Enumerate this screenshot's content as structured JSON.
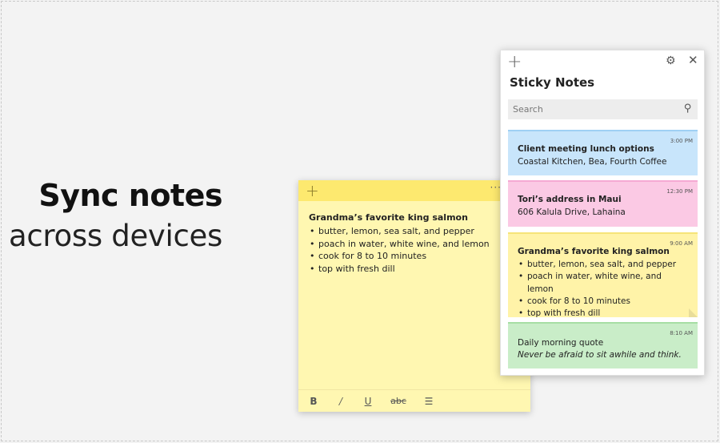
{
  "hero": {
    "line1": "Sync notes",
    "line2": "across devices"
  },
  "open_note": {
    "add_icon": "plus-icon",
    "menu_label": "···",
    "title": "Grandma’s favorite king salmon",
    "items": [
      "butter, lemon, sea salt, and pepper",
      "poach in water, white wine, and lemon",
      "cook for 8 to 10 minutes",
      "top with fresh dill"
    ],
    "toolbar": {
      "bold": "B",
      "italic": "/",
      "underline": "U",
      "strike": "abc",
      "list": "☰"
    },
    "color": "#fff7b1"
  },
  "panel": {
    "add_icon": "+",
    "gear_icon": "⚙",
    "close_icon": "✕",
    "title": "Sticky Notes",
    "search_placeholder": "Search",
    "search_icon": "⚲",
    "notes": [
      {
        "time": "3:00 PM",
        "title": "Client meeting lunch options",
        "line": "Coastal Kitchen, Bea, Fourth Coffee",
        "color": "#c8e5fb"
      },
      {
        "time": "12:30 PM",
        "title": "Tori’s address in Maui",
        "line": "606 Kalula Drive, Lahaina",
        "color": "#fbc9e4"
      },
      {
        "time": "9:00 AM",
        "title": "Grandma’s favorite king salmon",
        "items": [
          "butter, lemon, sea salt, and pepper",
          "poach in water, white wine, and lemon",
          "cook for 8 to 10 minutes",
          "top with fresh dill"
        ],
        "color": "#fff3a8"
      },
      {
        "time": "8:10 AM",
        "line": "Daily morning quote",
        "italic": "Never be afraid to sit awhile and think.",
        "color": "#c9edc8"
      }
    ]
  }
}
